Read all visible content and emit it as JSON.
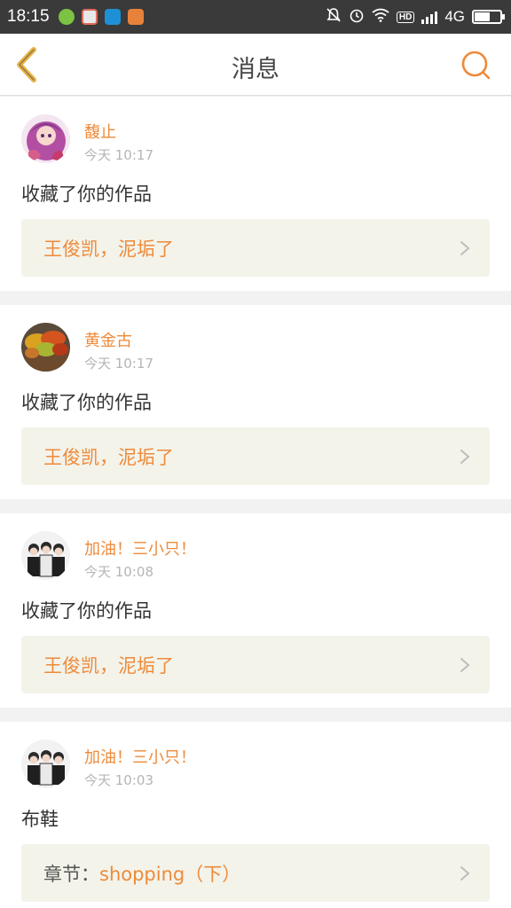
{
  "status_bar": {
    "time": "18:15",
    "network": "4G",
    "hd_label": "HD",
    "battery_level": 0.6,
    "apps": [
      "green-app-icon",
      "gallery-app-icon",
      "scanner-app-icon",
      "orange-app-icon"
    ]
  },
  "nav": {
    "title": "消息",
    "back_icon": "chevron-left-icon",
    "search_icon": "search-icon",
    "accent": "#ee8a3a"
  },
  "messages": [
    {
      "user": "馥止",
      "time": "今天 10:17",
      "action": "收藏了你的作品",
      "ref_prefix": "",
      "ref_title": "王俊凯，泥垢了",
      "avatar": "anime-avatar"
    },
    {
      "user": "黄金古",
      "time": "今天 10:17",
      "action": "收藏了你的作品",
      "ref_prefix": "",
      "ref_title": "王俊凯，泥垢了",
      "avatar": "autumn-leaves-avatar"
    },
    {
      "user": "加油！三小只！",
      "time": "今天 10:08",
      "action": "收藏了你的作品",
      "ref_prefix": "",
      "ref_title": "王俊凯，泥垢了",
      "avatar": "group-photo-avatar"
    },
    {
      "user": "加油！三小只！",
      "time": "今天 10:03",
      "action": "布鞋",
      "ref_prefix": "章节：",
      "ref_title": "shopping（下）",
      "avatar": "group-photo-avatar"
    }
  ]
}
